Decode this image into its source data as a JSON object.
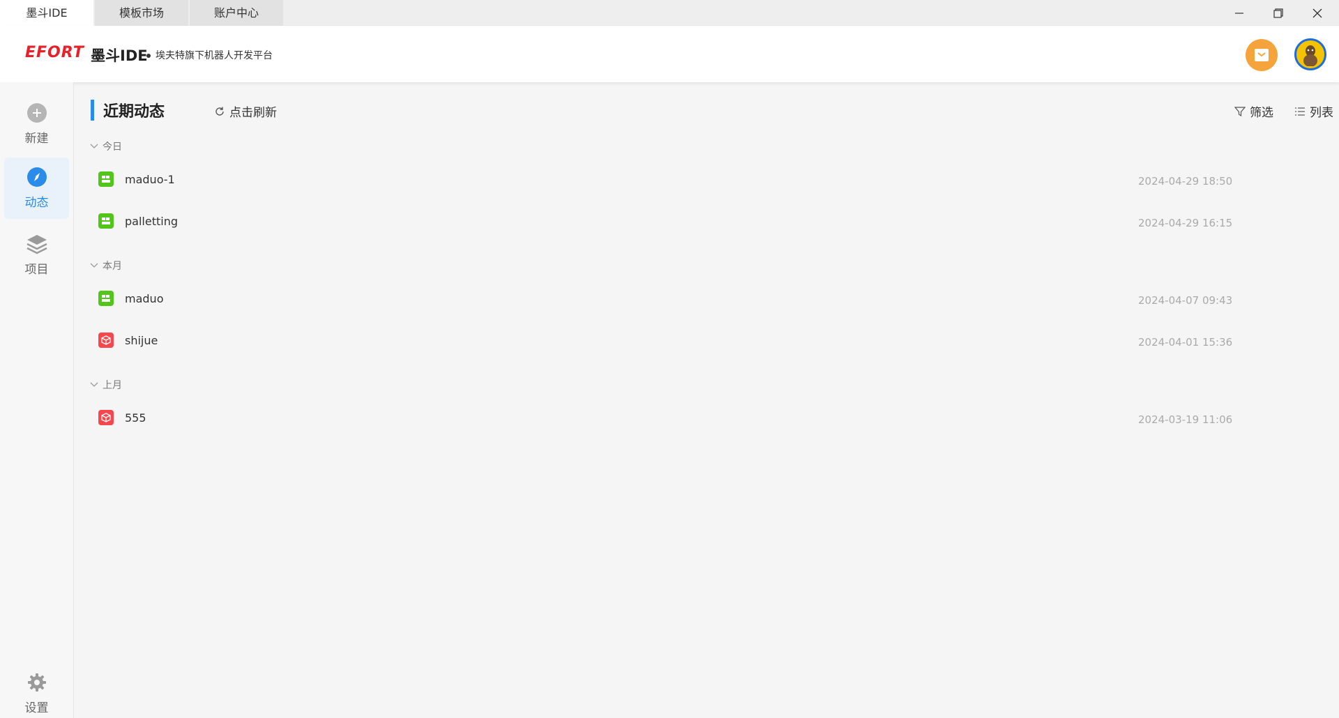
{
  "tabs": [
    {
      "label": "墨斗IDE"
    },
    {
      "label": "模板市场"
    },
    {
      "label": "账户中心"
    }
  ],
  "header": {
    "logo_text": "EFORT",
    "app_name": "墨斗IDE",
    "subtitle": "埃夫特旗下机器人开发平台"
  },
  "sidebar": {
    "new_label": "新建",
    "activity_label": "动态",
    "project_label": "项目",
    "settings_label": "设置"
  },
  "main": {
    "title": "近期动态",
    "refresh_label": "点击刷新",
    "filter_label": "筛选",
    "list_label": "列表",
    "groups": [
      {
        "label": "今日",
        "items": [
          {
            "name": "maduo-1",
            "time": "2024-04-29 18:50",
            "type": "palletizing"
          },
          {
            "name": "palletting",
            "time": "2024-04-29 16:15",
            "type": "palletizing"
          }
        ]
      },
      {
        "label": "本月",
        "items": [
          {
            "name": "maduo",
            "time": "2024-04-07 09:43",
            "type": "palletizing"
          },
          {
            "name": "shijue",
            "time": "2024-04-01 15:36",
            "type": "vision"
          }
        ]
      },
      {
        "label": "上月",
        "items": [
          {
            "name": "555",
            "time": "2024-03-19 11:06",
            "type": "vision"
          }
        ]
      }
    ]
  },
  "colors": {
    "accent": "#2a8ce8",
    "brand_red": "#e8202a",
    "palletizing_green": "#52c41a",
    "vision_red": "#f5484e",
    "mail_orange": "#f5a33b"
  }
}
